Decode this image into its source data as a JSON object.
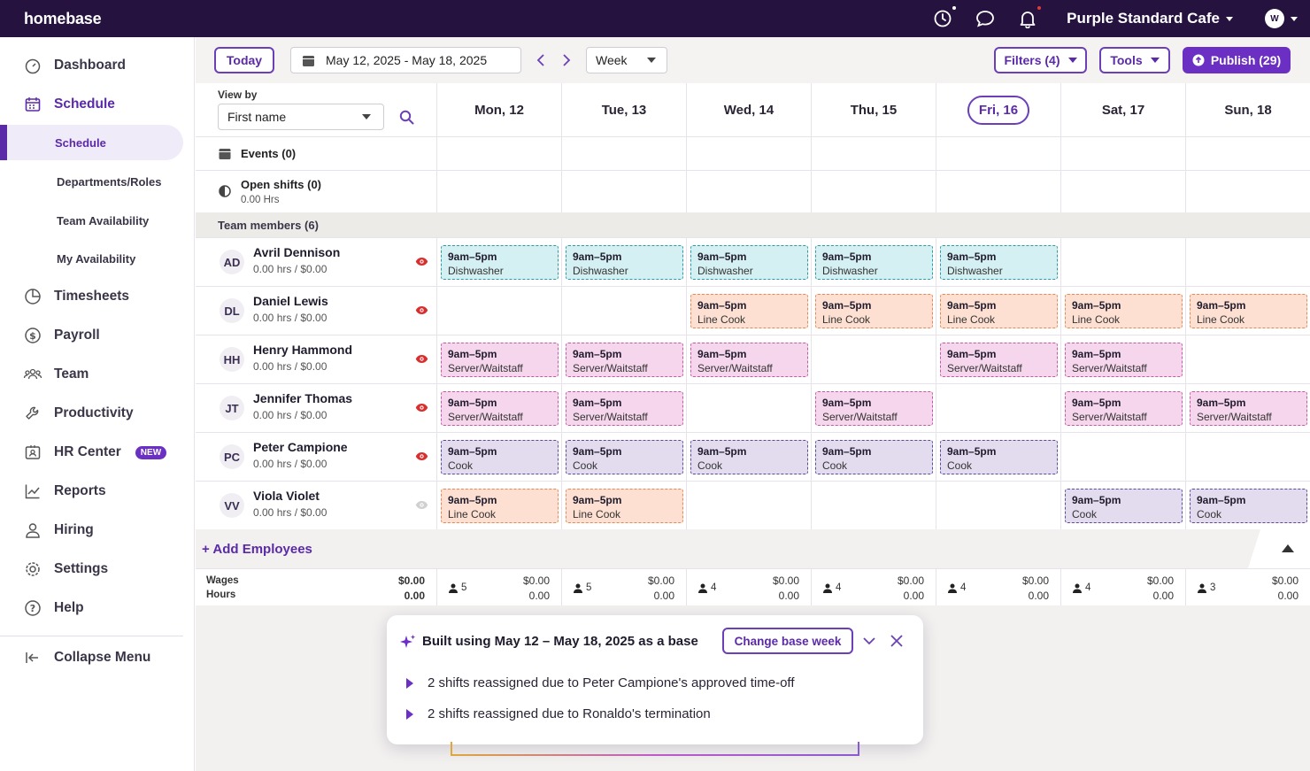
{
  "app": {
    "logo": "homebase",
    "company": "Purple Standard Cafe",
    "user_initials": "W"
  },
  "sidebar": {
    "items": [
      {
        "label": "Dashboard",
        "icon": "dashboard-icon"
      },
      {
        "label": "Schedule",
        "icon": "calendar-icon"
      },
      {
        "label": "Timesheets",
        "icon": "clock-icon"
      },
      {
        "label": "Payroll",
        "icon": "dollar-icon"
      },
      {
        "label": "Team",
        "icon": "team-icon"
      },
      {
        "label": "Productivity",
        "icon": "wrench-icon"
      },
      {
        "label": "HR Center",
        "icon": "badge-icon",
        "badge": "NEW"
      },
      {
        "label": "Reports",
        "icon": "chart-icon"
      },
      {
        "label": "Hiring",
        "icon": "person-icon"
      },
      {
        "label": "Settings",
        "icon": "gear-icon"
      },
      {
        "label": "Help",
        "icon": "help-icon"
      }
    ],
    "sub_items": [
      "Schedule",
      "Departments/Roles",
      "Team Availability",
      "My Availability"
    ],
    "collapse": "Collapse Menu"
  },
  "toolbar": {
    "today": "Today",
    "date_range": "May 12, 2025 - May 18, 2025",
    "view": "Week",
    "filters": "Filters (4)",
    "tools": "Tools",
    "publish": "Publish (29)"
  },
  "view_by": {
    "label": "View by",
    "value": "First name"
  },
  "days": [
    "Mon, 12",
    "Tue, 13",
    "Wed, 14",
    "Thu, 15",
    "Fri, 16",
    "Sat, 17",
    "Sun, 18"
  ],
  "today_index": 4,
  "rows": {
    "events": "Events (0)",
    "open_shifts": "Open shifts (0)",
    "open_hours": "0.00 Hrs",
    "team_members": "Team members (6)"
  },
  "employees": [
    {
      "initials": "AD",
      "name": "Avril Dennison",
      "summary": "0.00 hrs / $0.00",
      "visible": true,
      "shifts": [
        {
          "time": "9am–5pm",
          "role": "Dishwasher",
          "kind": "dish"
        },
        {
          "time": "9am–5pm",
          "role": "Dishwasher",
          "kind": "dish"
        },
        {
          "time": "9am–5pm",
          "role": "Dishwasher",
          "kind": "dish"
        },
        {
          "time": "9am–5pm",
          "role": "Dishwasher",
          "kind": "dish"
        },
        {
          "time": "9am–5pm",
          "role": "Dishwasher",
          "kind": "dish"
        },
        null,
        null
      ]
    },
    {
      "initials": "DL",
      "name": "Daniel Lewis",
      "summary": "0.00 hrs / $0.00",
      "visible": true,
      "shifts": [
        null,
        null,
        {
          "time": "9am–5pm",
          "role": "Line Cook",
          "kind": "line"
        },
        {
          "time": "9am–5pm",
          "role": "Line Cook",
          "kind": "line"
        },
        {
          "time": "9am–5pm",
          "role": "Line Cook",
          "kind": "line"
        },
        {
          "time": "9am–5pm",
          "role": "Line Cook",
          "kind": "line"
        },
        {
          "time": "9am–5pm",
          "role": "Line Cook",
          "kind": "line"
        }
      ]
    },
    {
      "initials": "HH",
      "name": "Henry Hammond",
      "summary": "0.00 hrs / $0.00",
      "visible": true,
      "shifts": [
        {
          "time": "9am–5pm",
          "role": "Server/Waitstaff",
          "kind": "serv"
        },
        {
          "time": "9am–5pm",
          "role": "Server/Waitstaff",
          "kind": "serv"
        },
        {
          "time": "9am–5pm",
          "role": "Server/Waitstaff",
          "kind": "serv"
        },
        null,
        {
          "time": "9am–5pm",
          "role": "Server/Waitstaff",
          "kind": "serv"
        },
        {
          "time": "9am–5pm",
          "role": "Server/Waitstaff",
          "kind": "serv"
        },
        null
      ]
    },
    {
      "initials": "JT",
      "name": "Jennifer Thomas",
      "summary": "0.00 hrs / $0.00",
      "visible": true,
      "shifts": [
        {
          "time": "9am–5pm",
          "role": "Server/Waitstaff",
          "kind": "serv"
        },
        {
          "time": "9am–5pm",
          "role": "Server/Waitstaff",
          "kind": "serv"
        },
        null,
        {
          "time": "9am–5pm",
          "role": "Server/Waitstaff",
          "kind": "serv"
        },
        null,
        {
          "time": "9am–5pm",
          "role": "Server/Waitstaff",
          "kind": "serv"
        },
        {
          "time": "9am–5pm",
          "role": "Server/Waitstaff",
          "kind": "serv"
        }
      ]
    },
    {
      "initials": "PC",
      "name": "Peter Campione",
      "summary": "0.00 hrs / $0.00",
      "visible": true,
      "shifts": [
        {
          "time": "9am–5pm",
          "role": "Cook",
          "kind": "cook"
        },
        {
          "time": "9am–5pm",
          "role": "Cook",
          "kind": "cook"
        },
        {
          "time": "9am–5pm",
          "role": "Cook",
          "kind": "cook"
        },
        {
          "time": "9am–5pm",
          "role": "Cook",
          "kind": "cook"
        },
        {
          "time": "9am–5pm",
          "role": "Cook",
          "kind": "cook"
        },
        null,
        null
      ]
    },
    {
      "initials": "VV",
      "name": "Viola Violet",
      "summary": "0.00 hrs / $0.00",
      "visible": false,
      "shifts": [
        {
          "time": "9am–5pm",
          "role": "Line Cook",
          "kind": "line"
        },
        {
          "time": "9am–5pm",
          "role": "Line Cook",
          "kind": "line"
        },
        null,
        null,
        null,
        {
          "time": "9am–5pm",
          "role": "Cook",
          "kind": "cook"
        },
        {
          "time": "9am–5pm",
          "role": "Cook",
          "kind": "cook"
        }
      ]
    }
  ],
  "add_employees": "+ Add Employees",
  "totals": {
    "wages_label": "Wages",
    "hours_label": "Hours",
    "overall_wages": "$0.00",
    "overall_hours": "0.00",
    "days": [
      {
        "count": "5",
        "wages": "$0.00",
        "hours": "0.00"
      },
      {
        "count": "5",
        "wages": "$0.00",
        "hours": "0.00"
      },
      {
        "count": "4",
        "wages": "$0.00",
        "hours": "0.00"
      },
      {
        "count": "4",
        "wages": "$0.00",
        "hours": "0.00"
      },
      {
        "count": "4",
        "wages": "$0.00",
        "hours": "0.00"
      },
      {
        "count": "4",
        "wages": "$0.00",
        "hours": "0.00"
      },
      {
        "count": "3",
        "wages": "$0.00",
        "hours": "0.00"
      }
    ]
  },
  "panel": {
    "title": "Built using May 12 – May 18, 2025 as a base",
    "change_button": "Change base week",
    "items": [
      "2 shifts reassigned due to Peter Campione's approved time-off",
      "2 shifts reassigned due to Ronaldo's termination"
    ]
  },
  "colors": {
    "brand": "#25123f",
    "accent": "#6c2fc4",
    "dishwasher": "#d5f0f2",
    "line_cook": "#fde0d2",
    "server": "#f6d6ec",
    "cook": "#e3dcef"
  }
}
